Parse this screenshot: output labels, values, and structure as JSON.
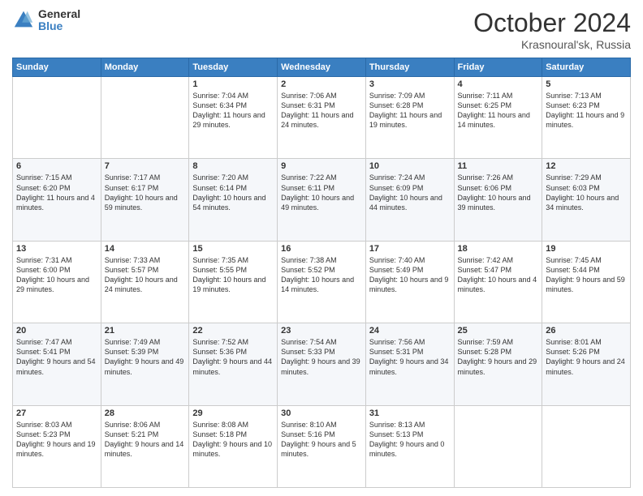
{
  "logo": {
    "general": "General",
    "blue": "Blue"
  },
  "title": {
    "month": "October 2024",
    "location": "Krasnoural'sk, Russia"
  },
  "header_days": [
    "Sunday",
    "Monday",
    "Tuesday",
    "Wednesday",
    "Thursday",
    "Friday",
    "Saturday"
  ],
  "weeks": [
    [
      {
        "day": "",
        "sunrise": "",
        "sunset": "",
        "daylight": ""
      },
      {
        "day": "",
        "sunrise": "",
        "sunset": "",
        "daylight": ""
      },
      {
        "day": "1",
        "sunrise": "Sunrise: 7:04 AM",
        "sunset": "Sunset: 6:34 PM",
        "daylight": "Daylight: 11 hours and 29 minutes."
      },
      {
        "day": "2",
        "sunrise": "Sunrise: 7:06 AM",
        "sunset": "Sunset: 6:31 PM",
        "daylight": "Daylight: 11 hours and 24 minutes."
      },
      {
        "day": "3",
        "sunrise": "Sunrise: 7:09 AM",
        "sunset": "Sunset: 6:28 PM",
        "daylight": "Daylight: 11 hours and 19 minutes."
      },
      {
        "day": "4",
        "sunrise": "Sunrise: 7:11 AM",
        "sunset": "Sunset: 6:25 PM",
        "daylight": "Daylight: 11 hours and 14 minutes."
      },
      {
        "day": "5",
        "sunrise": "Sunrise: 7:13 AM",
        "sunset": "Sunset: 6:23 PM",
        "daylight": "Daylight: 11 hours and 9 minutes."
      }
    ],
    [
      {
        "day": "6",
        "sunrise": "Sunrise: 7:15 AM",
        "sunset": "Sunset: 6:20 PM",
        "daylight": "Daylight: 11 hours and 4 minutes."
      },
      {
        "day": "7",
        "sunrise": "Sunrise: 7:17 AM",
        "sunset": "Sunset: 6:17 PM",
        "daylight": "Daylight: 10 hours and 59 minutes."
      },
      {
        "day": "8",
        "sunrise": "Sunrise: 7:20 AM",
        "sunset": "Sunset: 6:14 PM",
        "daylight": "Daylight: 10 hours and 54 minutes."
      },
      {
        "day": "9",
        "sunrise": "Sunrise: 7:22 AM",
        "sunset": "Sunset: 6:11 PM",
        "daylight": "Daylight: 10 hours and 49 minutes."
      },
      {
        "day": "10",
        "sunrise": "Sunrise: 7:24 AM",
        "sunset": "Sunset: 6:09 PM",
        "daylight": "Daylight: 10 hours and 44 minutes."
      },
      {
        "day": "11",
        "sunrise": "Sunrise: 7:26 AM",
        "sunset": "Sunset: 6:06 PM",
        "daylight": "Daylight: 10 hours and 39 minutes."
      },
      {
        "day": "12",
        "sunrise": "Sunrise: 7:29 AM",
        "sunset": "Sunset: 6:03 PM",
        "daylight": "Daylight: 10 hours and 34 minutes."
      }
    ],
    [
      {
        "day": "13",
        "sunrise": "Sunrise: 7:31 AM",
        "sunset": "Sunset: 6:00 PM",
        "daylight": "Daylight: 10 hours and 29 minutes."
      },
      {
        "day": "14",
        "sunrise": "Sunrise: 7:33 AM",
        "sunset": "Sunset: 5:57 PM",
        "daylight": "Daylight: 10 hours and 24 minutes."
      },
      {
        "day": "15",
        "sunrise": "Sunrise: 7:35 AM",
        "sunset": "Sunset: 5:55 PM",
        "daylight": "Daylight: 10 hours and 19 minutes."
      },
      {
        "day": "16",
        "sunrise": "Sunrise: 7:38 AM",
        "sunset": "Sunset: 5:52 PM",
        "daylight": "Daylight: 10 hours and 14 minutes."
      },
      {
        "day": "17",
        "sunrise": "Sunrise: 7:40 AM",
        "sunset": "Sunset: 5:49 PM",
        "daylight": "Daylight: 10 hours and 9 minutes."
      },
      {
        "day": "18",
        "sunrise": "Sunrise: 7:42 AM",
        "sunset": "Sunset: 5:47 PM",
        "daylight": "Daylight: 10 hours and 4 minutes."
      },
      {
        "day": "19",
        "sunrise": "Sunrise: 7:45 AM",
        "sunset": "Sunset: 5:44 PM",
        "daylight": "Daylight: 9 hours and 59 minutes."
      }
    ],
    [
      {
        "day": "20",
        "sunrise": "Sunrise: 7:47 AM",
        "sunset": "Sunset: 5:41 PM",
        "daylight": "Daylight: 9 hours and 54 minutes."
      },
      {
        "day": "21",
        "sunrise": "Sunrise: 7:49 AM",
        "sunset": "Sunset: 5:39 PM",
        "daylight": "Daylight: 9 hours and 49 minutes."
      },
      {
        "day": "22",
        "sunrise": "Sunrise: 7:52 AM",
        "sunset": "Sunset: 5:36 PM",
        "daylight": "Daylight: 9 hours and 44 minutes."
      },
      {
        "day": "23",
        "sunrise": "Sunrise: 7:54 AM",
        "sunset": "Sunset: 5:33 PM",
        "daylight": "Daylight: 9 hours and 39 minutes."
      },
      {
        "day": "24",
        "sunrise": "Sunrise: 7:56 AM",
        "sunset": "Sunset: 5:31 PM",
        "daylight": "Daylight: 9 hours and 34 minutes."
      },
      {
        "day": "25",
        "sunrise": "Sunrise: 7:59 AM",
        "sunset": "Sunset: 5:28 PM",
        "daylight": "Daylight: 9 hours and 29 minutes."
      },
      {
        "day": "26",
        "sunrise": "Sunrise: 8:01 AM",
        "sunset": "Sunset: 5:26 PM",
        "daylight": "Daylight: 9 hours and 24 minutes."
      }
    ],
    [
      {
        "day": "27",
        "sunrise": "Sunrise: 8:03 AM",
        "sunset": "Sunset: 5:23 PM",
        "daylight": "Daylight: 9 hours and 19 minutes."
      },
      {
        "day": "28",
        "sunrise": "Sunrise: 8:06 AM",
        "sunset": "Sunset: 5:21 PM",
        "daylight": "Daylight: 9 hours and 14 minutes."
      },
      {
        "day": "29",
        "sunrise": "Sunrise: 8:08 AM",
        "sunset": "Sunset: 5:18 PM",
        "daylight": "Daylight: 9 hours and 10 minutes."
      },
      {
        "day": "30",
        "sunrise": "Sunrise: 8:10 AM",
        "sunset": "Sunset: 5:16 PM",
        "daylight": "Daylight: 9 hours and 5 minutes."
      },
      {
        "day": "31",
        "sunrise": "Sunrise: 8:13 AM",
        "sunset": "Sunset: 5:13 PM",
        "daylight": "Daylight: 9 hours and 0 minutes."
      },
      {
        "day": "",
        "sunrise": "",
        "sunset": "",
        "daylight": ""
      },
      {
        "day": "",
        "sunrise": "",
        "sunset": "",
        "daylight": ""
      }
    ]
  ]
}
